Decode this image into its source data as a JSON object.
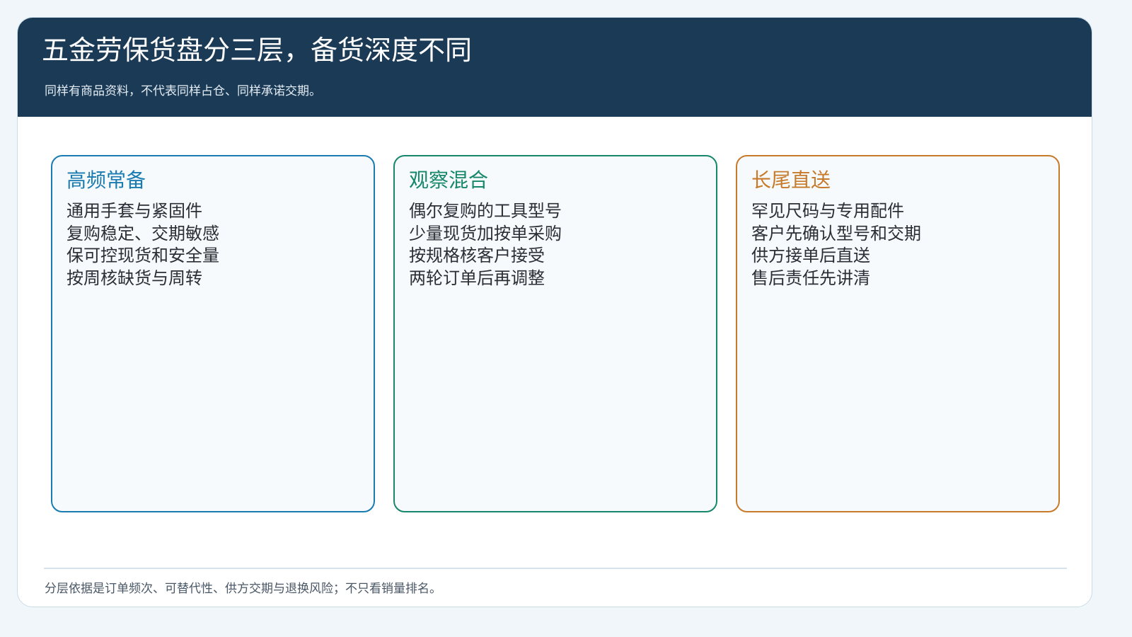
{
  "header": {
    "title": "五金劳保货盘分三层，备货深度不同",
    "subtitle": "同样有商品资料，不代表同样占仓、同样承诺交期。"
  },
  "cards": [
    {
      "title": "高频常备",
      "color": "#1a7bb0",
      "items": [
        "通用手套与紧固件",
        "复购稳定、交期敏感",
        "保可控现货和安全量",
        "按周核缺货与周转"
      ]
    },
    {
      "title": "观察混合",
      "color": "#16876a",
      "items": [
        "偶尔复购的工具型号",
        "少量现货加按单采购",
        "按规格核客户接受",
        "两轮订单后再调整"
      ]
    },
    {
      "title": "长尾直送",
      "color": "#c77a2a",
      "items": [
        "罕见尺码与专用配件",
        "客户先确认型号和交期",
        "供方接单后直送",
        "售后责任先讲清"
      ]
    }
  ],
  "footer": {
    "note": "分层依据是订单频次、可替代性、供方交期与退换风险；不只看销量排名。"
  }
}
